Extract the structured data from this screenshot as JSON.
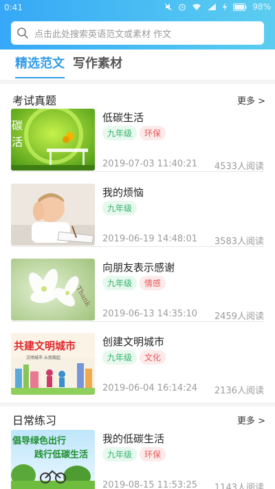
{
  "status": {
    "time": "0:41",
    "battery": "98%"
  },
  "search": {
    "placeholder": "点击此处搜索英语范文或素材  作文"
  },
  "tabs": [
    {
      "label": "精选范文",
      "active": true
    },
    {
      "label": "写作素材",
      "active": false
    }
  ],
  "sections": {
    "exam": {
      "title": "考试真题",
      "more": "更多 >"
    },
    "daily": {
      "title": "日常练习",
      "more": "更多 >"
    }
  },
  "items": [
    {
      "title": "低碳生活",
      "tags": [
        "九年级",
        "环保"
      ],
      "time": "2019-07-03 11:40:21",
      "reads": "4533人阅读",
      "thumb_text": "碳 活"
    },
    {
      "title": "我的烦恼",
      "tags": [
        "九年级"
      ],
      "time": "2019-06-19 14:48:01",
      "reads": "3583人阅读"
    },
    {
      "title": "向朋友表示感谢",
      "tags": [
        "九年级",
        "情感"
      ],
      "time": "2019-06-13 14:35:10",
      "reads": "2459人阅读",
      "thumb_text": "Thank"
    },
    {
      "title": "创建文明城市",
      "tags": [
        "九年级",
        "文化"
      ],
      "time": "2019-06-04 16:14:24",
      "reads": "2136人阅读",
      "thumb_text": "共建文明城市",
      "thumb_sub": "文明城市 从我做起"
    },
    {
      "title": "我的低碳生活",
      "tags": [
        "九年级",
        "环保"
      ],
      "time": "2019-08-15 11:53:25",
      "reads": "1143人阅读",
      "thumb_text": "倡导绿色出行",
      "thumb_sub": "践行低碳生活"
    }
  ],
  "colors": {
    "accent": "#2f9be8",
    "tag_green": "#35b26b",
    "tag_red": "#e85a5a"
  }
}
